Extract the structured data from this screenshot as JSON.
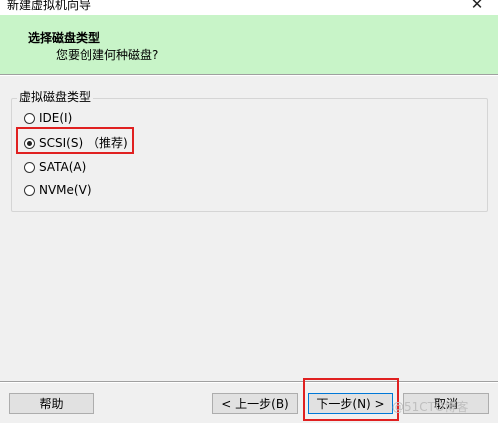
{
  "window": {
    "title": "新建虚拟机向导",
    "close_glyph": "✕"
  },
  "header": {
    "title": "选择磁盘类型",
    "subtitle": "您要创建何种磁盘?"
  },
  "disk_type_group": {
    "label": "虚拟磁盘类型",
    "options": [
      {
        "label": "IDE(I)",
        "selected": false
      },
      {
        "label": "SCSI(S) （推荐)",
        "selected": true
      },
      {
        "label": "SATA(A)",
        "selected": false
      },
      {
        "label": "NVMe(V)",
        "selected": false
      }
    ]
  },
  "buttons": {
    "help": "帮助",
    "back": "< 上一步(B)",
    "next": "下一步(N) >",
    "cancel": "取消"
  },
  "watermark": "@51CTO博客",
  "colors": {
    "header_bg": "#c8f4c8",
    "highlight": "#e02020",
    "default_button_border": "#0078d7"
  }
}
